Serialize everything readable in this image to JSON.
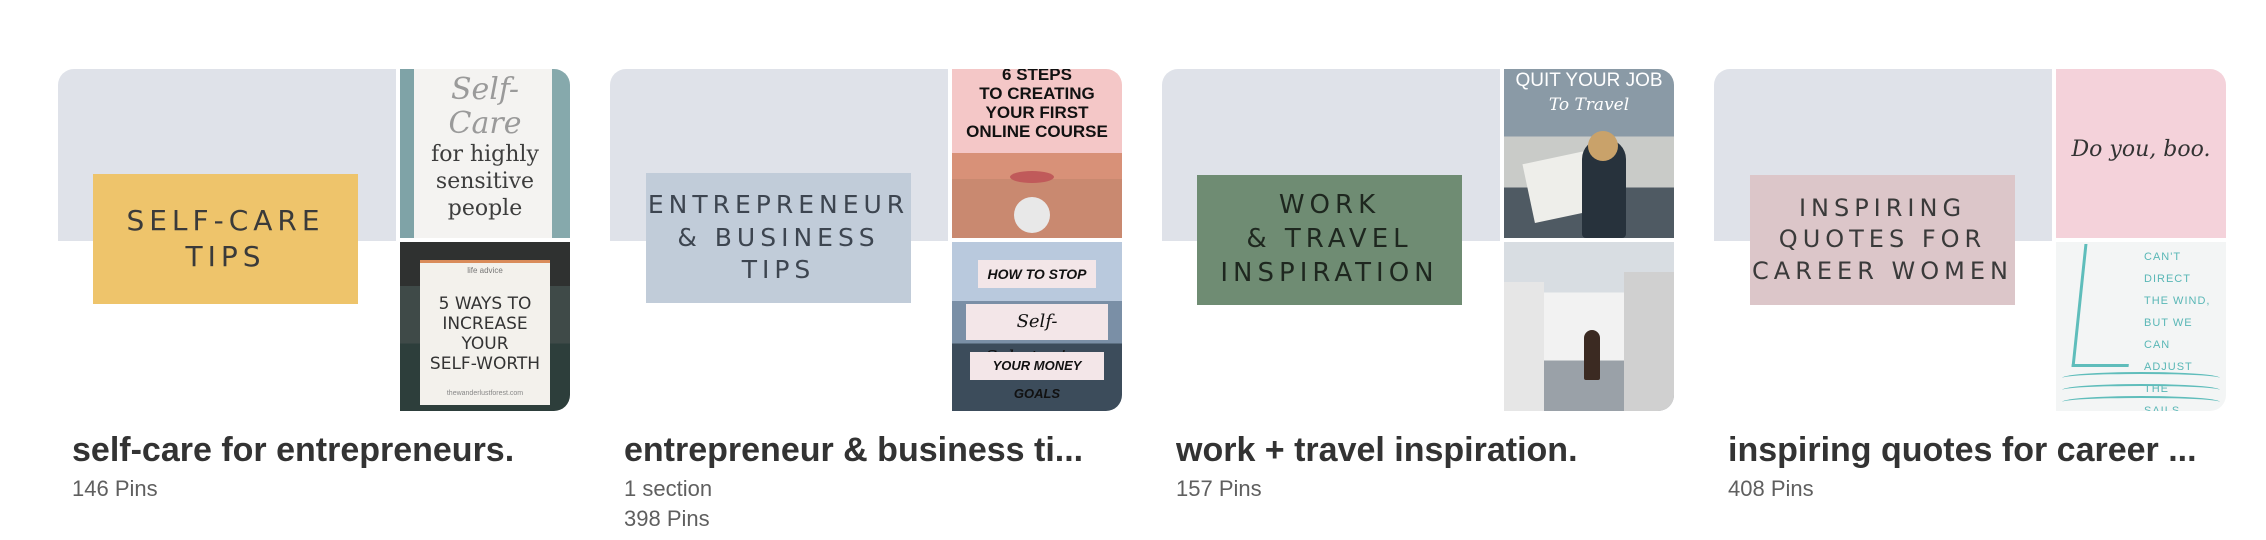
{
  "boards": [
    {
      "title": "self-care for entrepreneurs.",
      "meta": [
        "146 Pins"
      ],
      "cover_label": "SELF-CARE\nTIPS",
      "thumb_top": {
        "script": "Self-\nCare",
        "text": "for highly\nsensitive\npeople"
      },
      "thumb_bottom": {
        "small": "life advice",
        "text": "5 WAYS TO\nINCREASE\nYOUR\nSELF-WORTH",
        "foot": "thewanderlustforest.com"
      }
    },
    {
      "title": "entrepreneur & business ti...",
      "meta": [
        "1 section",
        "398 Pins"
      ],
      "cover_label": "ENTREPRENEUR\n& BUSINESS\nTIPS",
      "thumb_top": {
        "text": "6 STEPS\nTO CREATING\nYOUR FIRST\nONLINE COURSE"
      },
      "thumb_bottom": {
        "line1": "HOW TO STOP",
        "line2": "Self-Sabotaging",
        "line3": "YOUR MONEY GOALS"
      }
    },
    {
      "title": "work + travel inspiration.",
      "meta": [
        "157 Pins"
      ],
      "cover_label": "WORK\n& TRAVEL\nINSPIRATION",
      "thumb_top": {
        "text": "QUIT YOUR JOB",
        "text2": "To Travel"
      }
    },
    {
      "title": "inspiring quotes for career ...",
      "meta": [
        "408 Pins"
      ],
      "cover_label": "INSPIRING\nQUOTES FOR\nCAREER WOMEN",
      "thumb_top": {
        "text": "Do you, boo."
      },
      "thumb_bottom": {
        "text": "CAN'T\nDIRECT\nTHE WIND,\nBUT WE CAN\nADJUST THE\nSAILS."
      }
    }
  ],
  "colors": {
    "cover_bg": "#dfe2e9",
    "title": "#333333",
    "meta": "#5f5f5f"
  }
}
